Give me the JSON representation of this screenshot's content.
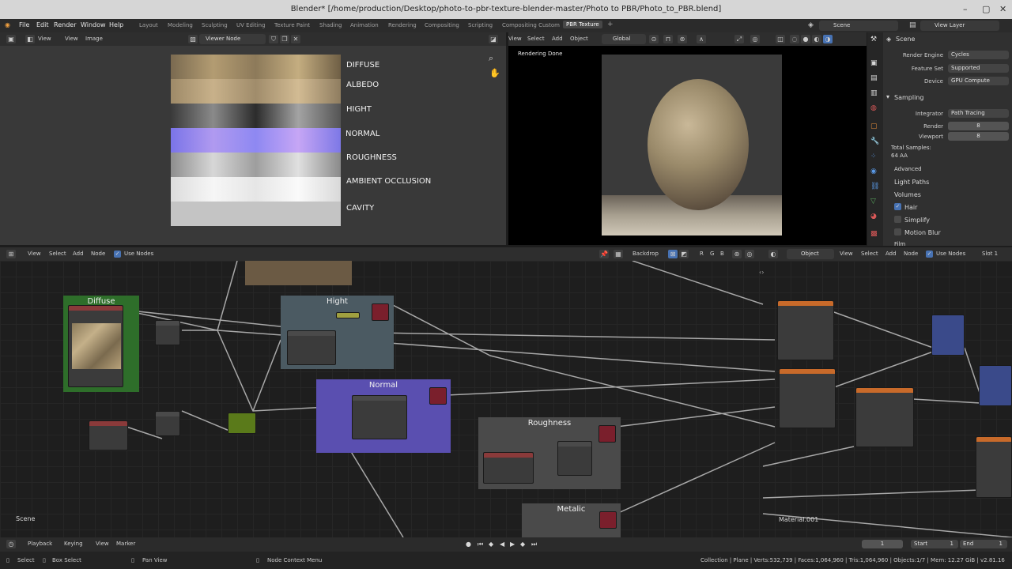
{
  "window": {
    "title": "Blender* [/home/production/Desktop/photo-to-pbr-texture-blender-master/Photo to PBR/Photo_to_PBR.blend]",
    "minimize": "–",
    "maximize": "▢",
    "close": "✕"
  },
  "menu": [
    "File",
    "Edit",
    "Render",
    "Window",
    "Help"
  ],
  "workspaces": [
    "Layout",
    "Modeling",
    "Sculpting",
    "UV Editing",
    "Texture Paint",
    "Shading",
    "Animation",
    "Rendering",
    "Compositing",
    "Scripting",
    "Compositing Custom",
    "PBR Texture"
  ],
  "active_workspace": "PBR Texture",
  "add_workspace": "+",
  "scene_selector": "Scene",
  "view_layer_selector": "View Layer",
  "image_editor": {
    "menu": [
      "View",
      "View",
      "Image"
    ],
    "image_name": "Viewer Node",
    "labels": [
      "DIFFUSE",
      "ALBEDO",
      "HIGHT",
      "NORMAL",
      "ROUGHNESS",
      "AMBIENT OCCLUSION",
      "CAVITY"
    ]
  },
  "viewport": {
    "menu": [
      "View",
      "Select",
      "Add",
      "Object"
    ],
    "orientation": "Global",
    "status": "Rendering Done"
  },
  "properties": {
    "scene": "Scene",
    "render_engine_label": "Render Engine",
    "render_engine": "Cycles",
    "feature_set_label": "Feature Set",
    "feature_set": "Supported",
    "device_label": "Device",
    "device": "GPU Compute",
    "sampling": "Sampling",
    "integrator_label": "Integrator",
    "integrator": "Path Tracing",
    "render_label": "Render",
    "render_samples": "8",
    "viewport_label": "Viewport",
    "viewport_samples": "8",
    "total_samples_label": "Total Samples:",
    "total_samples": "64 AA",
    "advanced": "Advanced",
    "light_paths": "Light Paths",
    "volumes": "Volumes",
    "hair": "Hair",
    "simplify": "Simplify",
    "motion_blur": "Motion Blur",
    "film": "Film"
  },
  "node_editor": {
    "menu": [
      "View",
      "Select",
      "Add",
      "Node"
    ],
    "use_nodes": "Use Nodes",
    "backdrop": "Backdrop",
    "channels": [
      "R",
      "G",
      "B"
    ],
    "object_selector": "Object",
    "menu_right": [
      "View",
      "Select",
      "Add",
      "Node"
    ],
    "use_nodes_right": "Use Nodes",
    "slot": "Slot 1",
    "frames": {
      "diffuse": "Diffuse",
      "hight": "Hight",
      "normal": "Normal",
      "roughness": "Roughness",
      "metalic": "Metalic"
    },
    "scene_label": "Scene",
    "material_label": "Material.001"
  },
  "timeline": {
    "menu": [
      "Playback",
      "Keying",
      "View",
      "Marker"
    ],
    "current_frame": "1",
    "start_label": "Start",
    "start": "1",
    "end_label": "End",
    "end": "1"
  },
  "status": {
    "select": "Select",
    "box_select": "Box Select",
    "pan_view": "Pan View",
    "context_menu": "Node Context Menu",
    "stats": "Collection | Plane | Verts:532,739 | Faces:1,064,960 | Tris:1,064,960 | Objects:1/7 | Mem: 12.27 GiB | v2.81.16"
  }
}
